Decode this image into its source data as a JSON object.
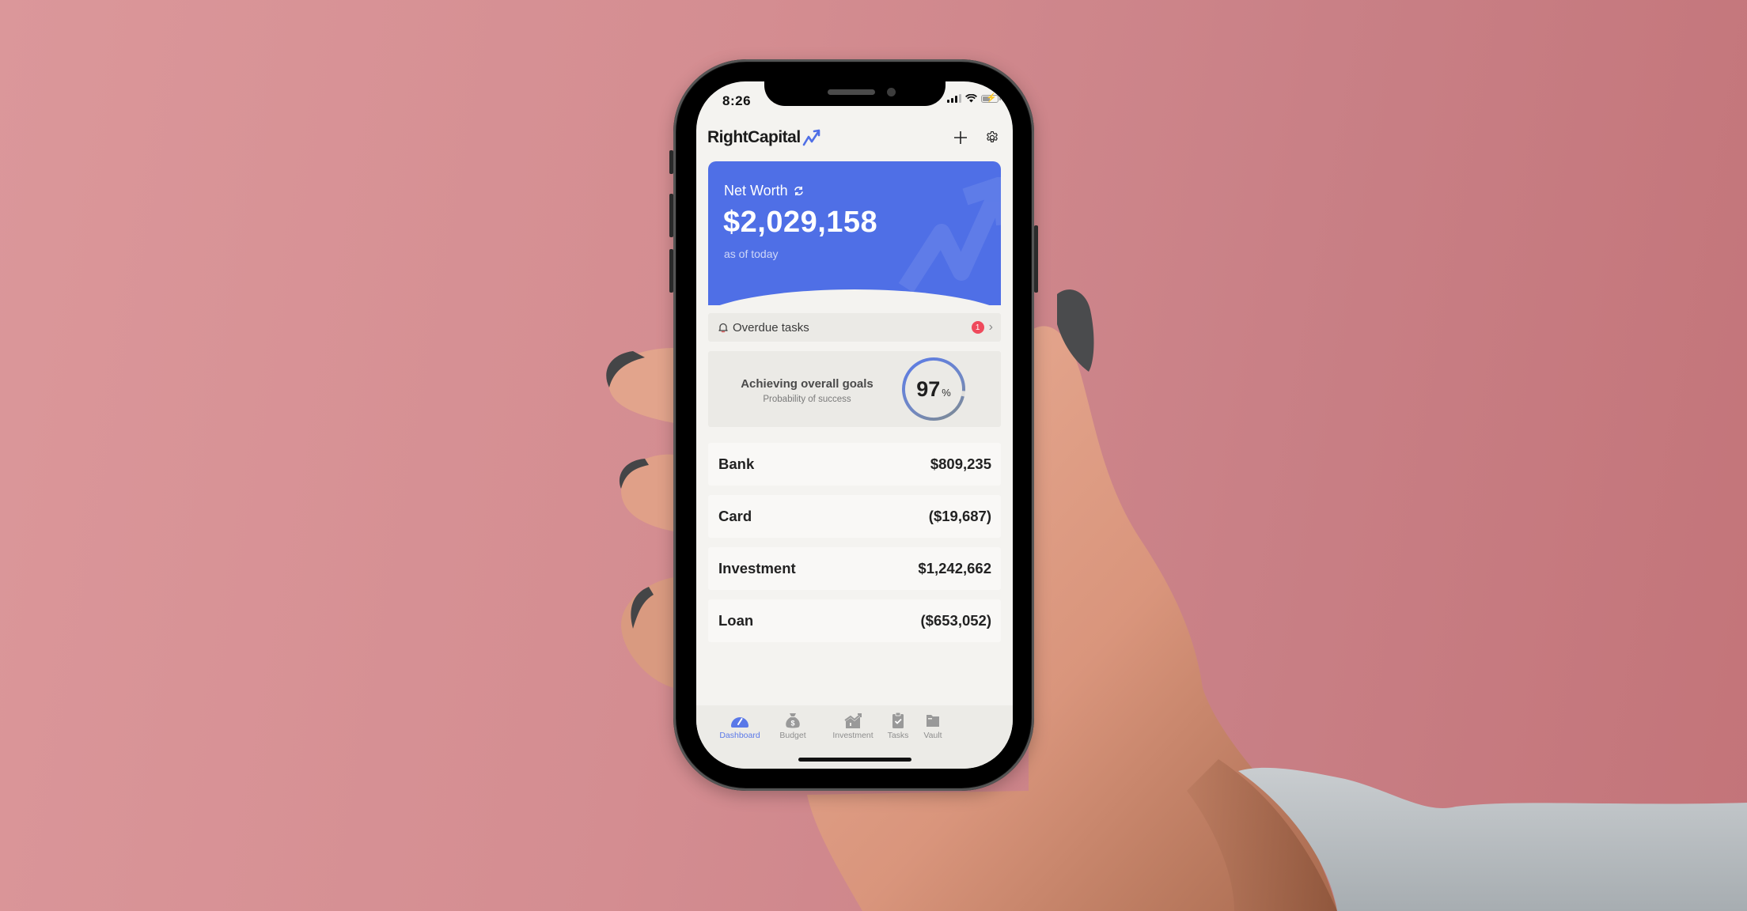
{
  "background": {
    "colors": [
      "#db979a",
      "#c37479"
    ]
  },
  "status_bar": {
    "time": "8:26"
  },
  "app": {
    "brand": "RightCapital",
    "accent": "#4f6fe6",
    "header_actions": [
      {
        "name": "add",
        "icon": "plus-icon"
      },
      {
        "name": "settings",
        "icon": "gear-icon"
      }
    ]
  },
  "net_worth": {
    "label": "Net Worth",
    "value": "$2,029,158",
    "subtitle": "as of today",
    "refresh_icon": "refresh-icon"
  },
  "overdue": {
    "label": "Overdue tasks",
    "count": "1",
    "badge_color": "#ef4a5c"
  },
  "goals": {
    "title": "Achieving overall goals",
    "subtitle": "Probability of success",
    "value": "97",
    "unit": "%",
    "probability": 0.97
  },
  "accounts": [
    {
      "name": "Bank",
      "value": "$809,235"
    },
    {
      "name": "Card",
      "value": "($19,687)"
    },
    {
      "name": "Investment",
      "value": "$1,242,662"
    },
    {
      "name": "Loan",
      "value": "($653,052)"
    }
  ],
  "tabs": [
    {
      "label": "Dashboard",
      "icon": "dashboard-gauge-icon",
      "active": true
    },
    {
      "label": "Budget",
      "icon": "money-bag-icon",
      "active": false
    },
    {
      "label": "Investment",
      "icon": "chart-growth-icon",
      "active": false
    },
    {
      "label": "Tasks",
      "icon": "clipboard-check-icon",
      "active": false
    },
    {
      "label": "Vault",
      "icon": "folder-icon",
      "active": false
    }
  ]
}
